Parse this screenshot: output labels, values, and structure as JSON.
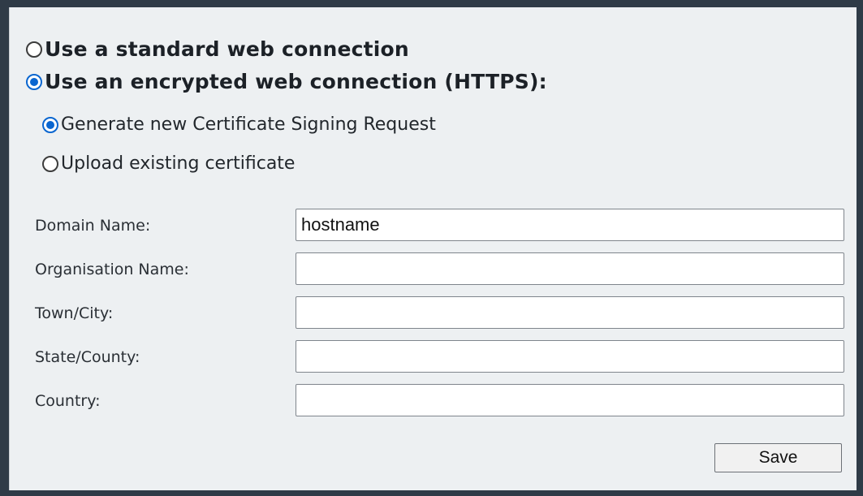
{
  "connection": {
    "standard_label": "Use a standard web connection",
    "standard_selected": false,
    "https_label": "Use an encrypted web connection (HTTPS):",
    "https_selected": true
  },
  "certificate": {
    "generate_label": "Generate new Certificate Signing Request",
    "generate_selected": true,
    "upload_label": "Upload existing certificate",
    "upload_selected": false
  },
  "form": {
    "fields": [
      {
        "label": "Domain Name:",
        "value": "hostname"
      },
      {
        "label": "Organisation Name:",
        "value": ""
      },
      {
        "label": "Town/City:",
        "value": ""
      },
      {
        "label": "State/County:",
        "value": ""
      },
      {
        "label": "Country:",
        "value": ""
      }
    ],
    "save_label": "Save"
  },
  "colors": {
    "accent": "#0a66d0",
    "panel_background": "#edf0f2",
    "frame": "#2f3b47"
  }
}
